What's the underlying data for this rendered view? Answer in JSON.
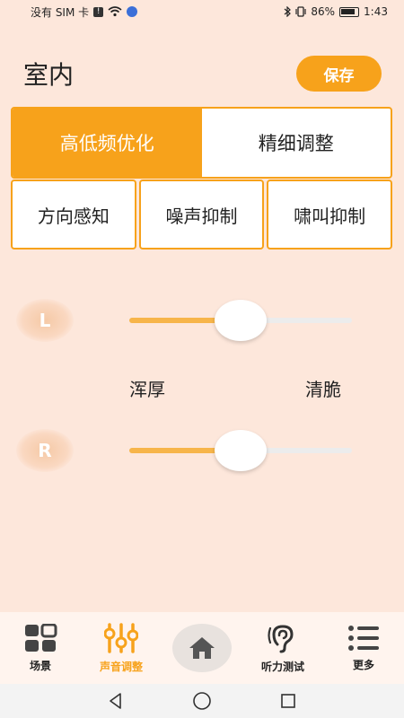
{
  "status_bar": {
    "carrier": "没有 SIM 卡",
    "battery": "86%",
    "time": "1:43"
  },
  "header": {
    "title": "室内",
    "save_label": "保存"
  },
  "tabs_row1": [
    {
      "label": "高低频优化",
      "active": true
    },
    {
      "label": "精细调整",
      "active": false
    }
  ],
  "tabs_row2": [
    {
      "label": "方向感知"
    },
    {
      "label": "噪声抑制"
    },
    {
      "label": "啸叫抑制"
    }
  ],
  "sliders": {
    "left": {
      "channel": "L",
      "value": 0.5
    },
    "right": {
      "channel": "R",
      "value": 0.5
    },
    "min_label": "浑厚",
    "max_label": "清脆"
  },
  "bottom_nav": [
    {
      "label": "场景",
      "icon": "grid-icon",
      "active": false
    },
    {
      "label": "声音调整",
      "icon": "equalizer-icon",
      "active": true
    },
    {
      "label": "",
      "icon": "home-icon",
      "active": false
    },
    {
      "label": "听力测试",
      "icon": "ear-icon",
      "active": false
    },
    {
      "label": "更多",
      "icon": "list-icon",
      "active": false
    }
  ],
  "colors": {
    "accent": "#f7a21b",
    "background": "#fde7db"
  }
}
